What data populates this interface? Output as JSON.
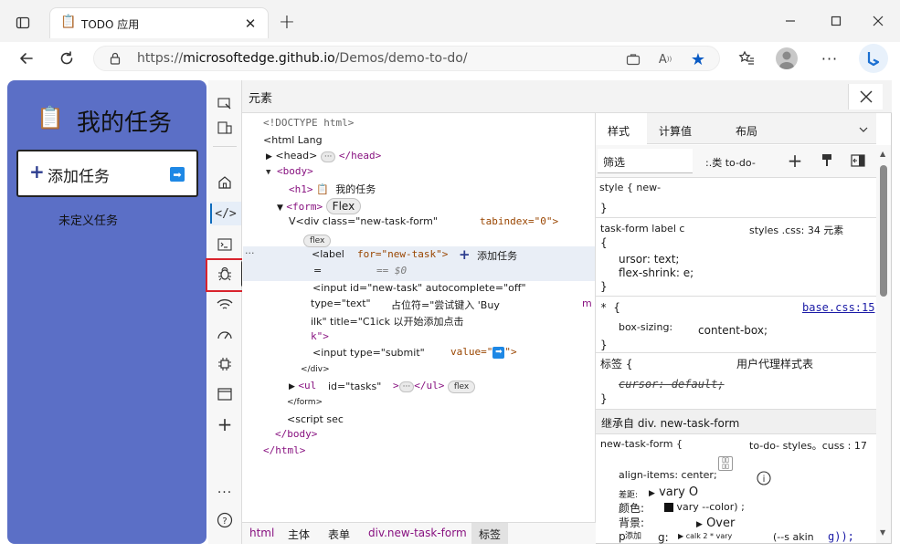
{
  "browser": {
    "tab_title": "TODO 应用",
    "url_prefix": "https://",
    "url_host": "microsoftedge.github.io",
    "url_path": "/Demos/demo-to-do/"
  },
  "app": {
    "title": "我的任务",
    "add_task_label": "添加任务",
    "undefined_tasks": "未定义任务",
    "accent": "#5b6fc6"
  },
  "devtools": {
    "panel_title": "元素",
    "tooltip": "源",
    "dom": {
      "doctype": "<!DOCTYPE html>",
      "html_open": "<html Lang",
      "head": "<head>",
      "head_close": "</head>",
      "body": "<body>",
      "h1_open": "<h1>",
      "h1_text": "我的任务",
      "form_open": "<form>",
      "flex_badge": "Flex",
      "div_open": "V<div class=\"new-task-form\"",
      "div_tabindex": "tabindex=\"0\">",
      "flex_small": "flex",
      "label_open": "<label",
      "label_for": "for=\"new-task\">",
      "label_text": "添加任务",
      "label_eq": "=",
      "label_dollar": "== $0",
      "input1_a": "<input id=\"new-task\" autocomplete=\"off\"",
      "input1_b": "type=\"text\"",
      "input1_c": "占位符=\"尝试键入 'Buy",
      "input1_m": "m",
      "input1_d": "ilk\" title=\"C1ick 以开始添加点击",
      "input1_e": "k\">",
      "input2_a": "<input type=\"submit\"",
      "input2_b": "value=\"",
      "input2_c": "\">",
      "div_close": "</div>",
      "ul_open": "<ul",
      "ul_id": "id=\"tasks\"",
      "ul_close": "</ul>",
      "form_close": "</form>",
      "script": "<script sec",
      "body_close": "</body>",
      "html_close": "</html>"
    },
    "breadcrumbs": [
      "html",
      "主体",
      "表单",
      "div.new-task-form",
      "标签"
    ],
    "styles": {
      "tabs": [
        "样式",
        "计算值",
        "布局"
      ],
      "filter_placeholder": "筛选",
      "cls_label": ":.类 to-do-",
      "rule0": "style { new-",
      "rule0_close": "}",
      "rule1_selector": "task-form label c",
      "rule1_source": "styles .css: 34 元素",
      "rule1_open": "{",
      "rule1_p1": "ursor: text;",
      "rule1_p2": "flex-shrink: e;",
      "rule1_close": "}",
      "rule2_selector": "* {",
      "rule2_source": "base.css:15",
      "rule2_p1_name": "box-sizing:",
      "rule2_p1_val": "content-box;",
      "rule2_close": "}",
      "rule3_selector": "标签 {",
      "rule3_source": "用户代理样式表",
      "rule3_p1": "cursor: default;",
      "rule3_close": "}",
      "inherited": "继承自 div. new-task-form",
      "rule4_selector": "new-task-form {",
      "rule4_source": "to-do- styles。cuss : 17",
      "rule4_p1": "align-items: center;",
      "rule4_p2_name": "差距:",
      "rule4_p2_val": "vary O",
      "rule4_p3_name": "颜色:",
      "rule4_p3_val": "vary --color) ;",
      "rule4_p4_name": "背景:",
      "rule4_p4_val": "Over",
      "rule4_p5_a": "p",
      "rule4_p5_b": "添加",
      "rule4_p5_c": "g:",
      "rule4_p5_d": "calk 2 * vary",
      "rule4_p5_e": "(--s akin",
      "rule4_p5_f": "g));"
    }
  }
}
